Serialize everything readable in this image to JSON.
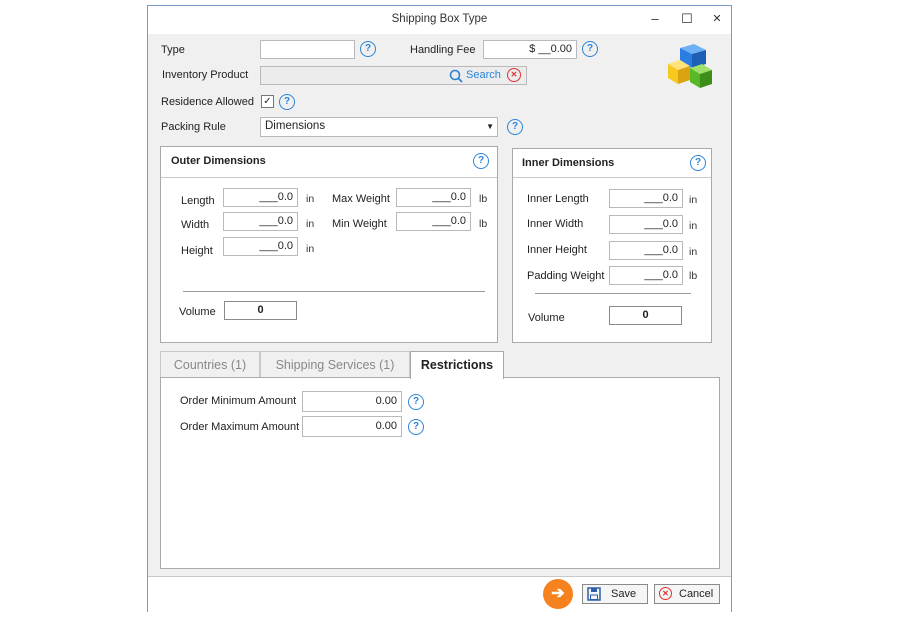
{
  "window": {
    "title": "Shipping Box Type",
    "minimize": "–",
    "maximize": "☐",
    "close": "✕"
  },
  "form": {
    "type_label": "Type",
    "type_value": "",
    "handling_fee_label": "Handling Fee",
    "handling_fee_value": "$ __0.00",
    "inventory_product_label": "Inventory Product",
    "search_label": "Search",
    "residence_allowed_label": "Residence Allowed",
    "residence_allowed_checked": "✓",
    "packing_rule_label": "Packing Rule",
    "packing_rule_value": "Dimensions"
  },
  "outer": {
    "title": "Outer Dimensions",
    "length_label": "Length",
    "length_value": "___0.0",
    "length_unit": "in",
    "width_label": "Width",
    "width_value": "___0.0",
    "width_unit": "in",
    "height_label": "Height",
    "height_value": "___0.0",
    "height_unit": "in",
    "max_weight_label": "Max Weight",
    "max_weight_value": "___0.0",
    "max_weight_unit": "lb",
    "min_weight_label": "Min Weight",
    "min_weight_value": "___0.0",
    "min_weight_unit": "lb",
    "volume_label": "Volume",
    "volume_value": "0"
  },
  "inner": {
    "title": "Inner Dimensions",
    "length_label": "Inner Length",
    "length_value": "___0.0",
    "length_unit": "in",
    "width_label": "Inner Width",
    "width_value": "___0.0",
    "width_unit": "in",
    "height_label": "Inner Height",
    "height_value": "___0.0",
    "height_unit": "in",
    "padding_label": "Padding Weight",
    "padding_value": "___0.0",
    "padding_unit": "lb",
    "volume_label": "Volume",
    "volume_value": "0"
  },
  "tabs": [
    {
      "label": "Countries (1)"
    },
    {
      "label": "Shipping Services (1)"
    },
    {
      "label": "Restrictions"
    }
  ],
  "restrictions": {
    "min_label": "Order Minimum Amount",
    "min_value": "0.00",
    "max_label": "Order Maximum Amount",
    "max_value": "0.00"
  },
  "footer": {
    "save_label": "Save",
    "cancel_label": "Cancel"
  },
  "icons": {
    "help": "?",
    "arrow": "➔",
    "cancel_x": "✕"
  },
  "colors": {
    "accent": "#2c84d6",
    "arrow_orange": "#f5821f",
    "cancel_red": "#e03030",
    "cube_blue": "#2a7de1",
    "cube_green": "#58b82a",
    "cube_yellow": "#f7c81e"
  }
}
